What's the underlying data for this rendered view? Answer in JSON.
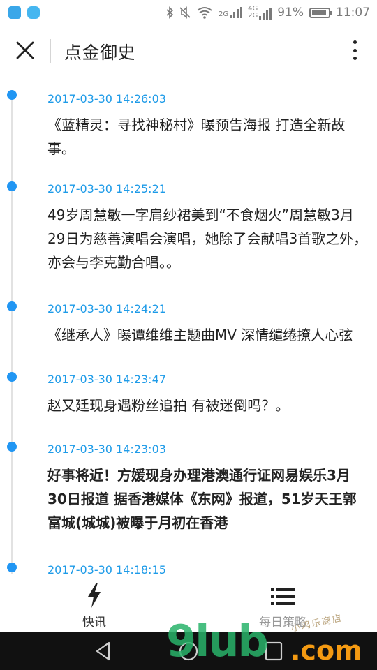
{
  "status_bar": {
    "battery_percent": "91%",
    "time": "11:07",
    "net_tag_1": "2G",
    "net_tag_2": "4G",
    "net_tag_3": "2G"
  },
  "header": {
    "title": "点金御史"
  },
  "timeline": [
    {
      "time": "2017-03-30 14:26:03",
      "text": "《蓝精灵：寻找神秘村》曝预告海报 打造全新故事。",
      "bold": false
    },
    {
      "time": "2017-03-30 14:25:21",
      "text": "49岁周慧敏一字肩纱裙美到“不食烟火”周慧敏3月29日为慈善演唱会演唱，她除了会献唱3首歌之外，亦会与李克勤合唱。。",
      "bold": false
    },
    {
      "time": "2017-03-30 14:24:21",
      "text": "《继承人》曝谭维维主题曲MV 深情缱绻撩人心弦",
      "bold": false
    },
    {
      "time": "2017-03-30 14:23:47",
      "text": "赵又廷现身遇粉丝追拍 有被迷倒吗？。",
      "bold": false
    },
    {
      "time": "2017-03-30 14:23:03",
      "text": "好事将近！方媛现身办理港澳通行证网易娱乐3月30日报道 据香港媒体《东网》报道，51岁天王郭富城(城城)被曝于月初在香港",
      "bold": true
    },
    {
      "time": "2017-03-30 14:18:15",
      "text": "",
      "bold": false
    }
  ],
  "bottom_nav": {
    "tab_flash": "快讯",
    "tab_strategy": "每日策略"
  },
  "watermark": {
    "main": "9lub",
    "domain": ".com",
    "small": "小鸡乐商店"
  },
  "colors": {
    "accent": "#2196f3",
    "time_text": "#1e9be8",
    "timeline_line": "#e2e2e2",
    "system_bar": "#111111"
  }
}
